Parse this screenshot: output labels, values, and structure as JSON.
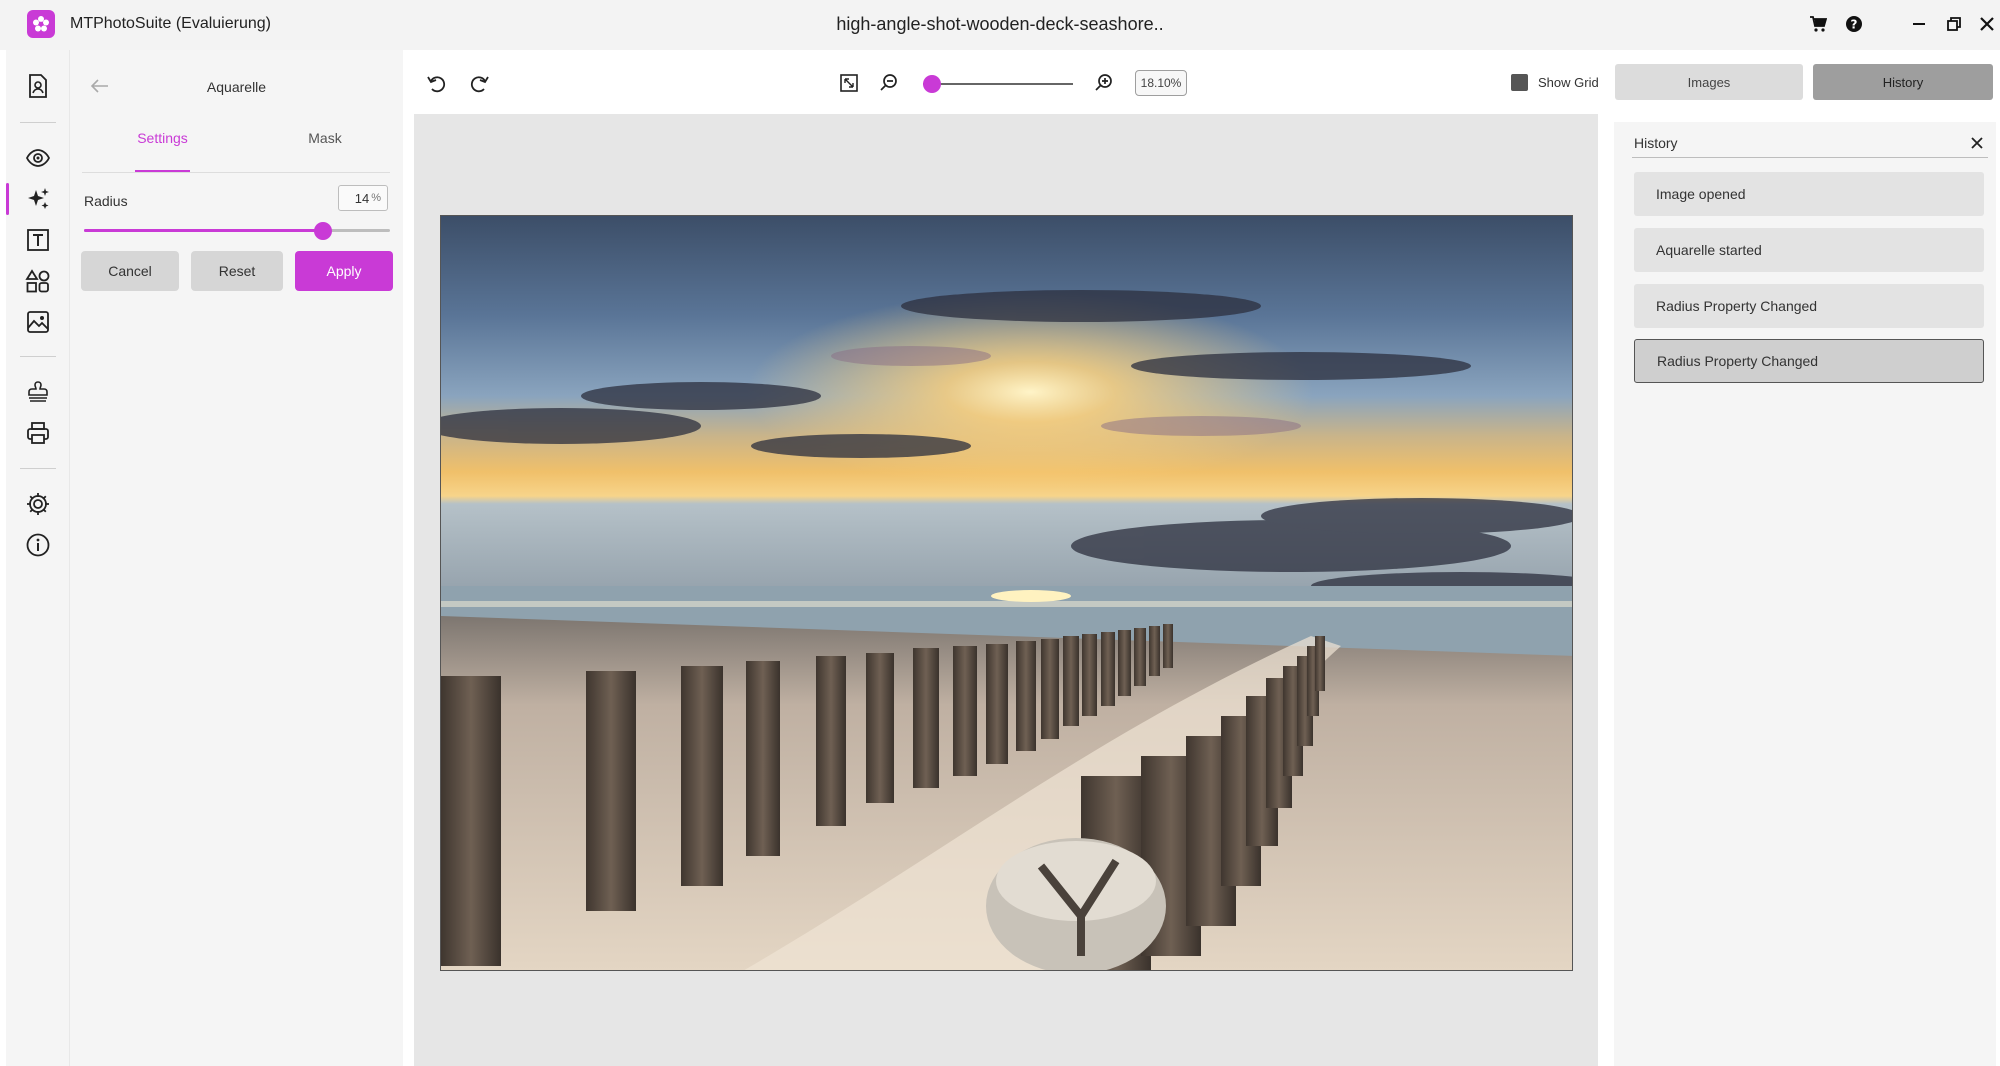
{
  "titlebar": {
    "app_name": "MTPhotoSuite (Evaluierung)",
    "document_name": "high-angle-shot-wooden-deck-seashore.."
  },
  "panel": {
    "title": "Aquarelle",
    "tabs": [
      {
        "label": "Settings",
        "active": true
      },
      {
        "label": "Mask",
        "active": false
      }
    ],
    "radius": {
      "label": "Radius",
      "value": "14",
      "unit": "%",
      "fraction": 0.78
    },
    "buttons": {
      "cancel": "Cancel",
      "reset": "Reset",
      "apply": "Apply"
    }
  },
  "toolbar": {
    "zoom_value": "18.10%",
    "zoom_fraction": 0.0,
    "show_grid_label": "Show Grid",
    "images_label": "Images",
    "history_label": "History"
  },
  "history": {
    "title": "History",
    "items": [
      {
        "label": "Image opened"
      },
      {
        "label": "Aquarelle started"
      },
      {
        "label": "Radius Property Changed"
      },
      {
        "label": "Radius Property Changed",
        "selected": true
      }
    ]
  },
  "colors": {
    "accent": "#c93ad6",
    "panel": "#f5f5f5",
    "canvas": "#e6e6e6"
  },
  "icons": {
    "rail": [
      "document-portrait-icon",
      "eye-icon",
      "sparkles-icon",
      "text-box-icon",
      "shapes-icon",
      "image-frame-icon",
      "stamp-icon",
      "printer-icon",
      "gear-icon",
      "info-icon"
    ],
    "titlebar": [
      "app-logo-icon",
      "cart-icon",
      "help-icon",
      "minimize-icon",
      "restore-icon",
      "close-icon"
    ],
    "toolbar": [
      "undo-icon",
      "redo-icon",
      "fit-screen-icon",
      "zoom-out-icon",
      "zoom-in-icon"
    ]
  }
}
